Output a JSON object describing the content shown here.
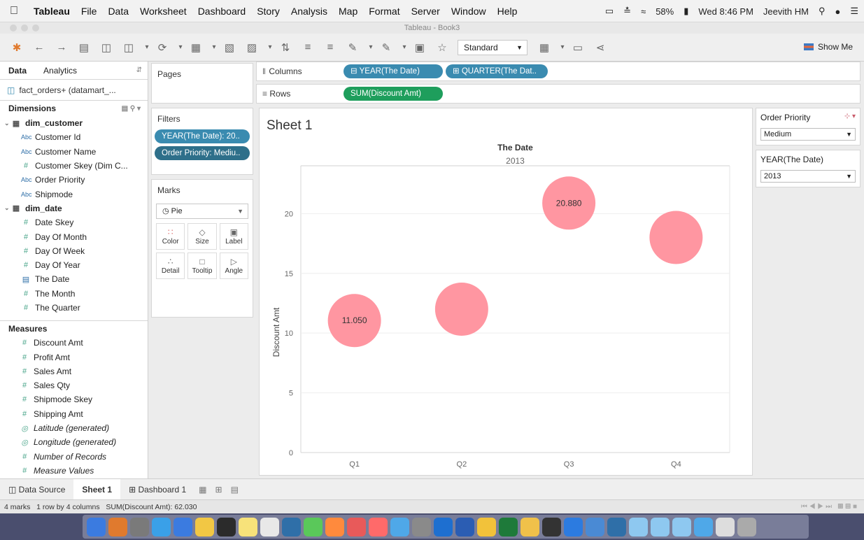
{
  "menubar": {
    "app": "Tableau",
    "items": [
      "File",
      "Data",
      "Worksheet",
      "Dashboard",
      "Story",
      "Analysis",
      "Map",
      "Format",
      "Server",
      "Window",
      "Help"
    ],
    "battery": "58%",
    "clock": "Wed 8:46 PM",
    "user": "Jeevith HM"
  },
  "window": {
    "title": "Tableau - Book3"
  },
  "toolbar": {
    "fit_select": "Standard",
    "show_me": "Show Me"
  },
  "data_pane": {
    "tab_data": "Data",
    "tab_analytics": "Analytics",
    "datasource": "fact_orders+ (datamart_...",
    "dimensions_label": "Dimensions",
    "dim_customer": {
      "name": "dim_customer",
      "fields": [
        {
          "type": "Abc",
          "name": "Customer Id"
        },
        {
          "type": "Abc",
          "name": "Customer Name"
        },
        {
          "type": "#",
          "name": "Customer Skey (Dim C..."
        },
        {
          "type": "Abc",
          "name": "Order Priority"
        },
        {
          "type": "Abc",
          "name": "Shipmode"
        }
      ]
    },
    "dim_date": {
      "name": "dim_date",
      "fields": [
        {
          "type": "#",
          "name": "Date Skey"
        },
        {
          "type": "#",
          "name": "Day Of Month"
        },
        {
          "type": "#",
          "name": "Day Of Week"
        },
        {
          "type": "#",
          "name": "Day Of Year"
        },
        {
          "type": "date",
          "name": "The Date"
        },
        {
          "type": "#",
          "name": "The Month"
        },
        {
          "type": "#",
          "name": "The Quarter"
        }
      ]
    },
    "measures_label": "Measures",
    "measures": [
      {
        "type": "#",
        "name": "Discount Amt",
        "italic": false
      },
      {
        "type": "#",
        "name": "Profit Amt",
        "italic": false
      },
      {
        "type": "#",
        "name": "Sales Amt",
        "italic": false
      },
      {
        "type": "#",
        "name": "Sales Qty",
        "italic": false
      },
      {
        "type": "#",
        "name": "Shipmode Skey",
        "italic": false
      },
      {
        "type": "#",
        "name": "Shipping Amt",
        "italic": false
      },
      {
        "type": "globe",
        "name": "Latitude (generated)",
        "italic": true
      },
      {
        "type": "globe",
        "name": "Longitude (generated)",
        "italic": true
      },
      {
        "type": "#",
        "name": "Number of Records",
        "italic": true
      },
      {
        "type": "#",
        "name": "Measure Values",
        "italic": true
      }
    ]
  },
  "cards": {
    "pages": "Pages",
    "filters": "Filters",
    "filter_pills": [
      "YEAR(The Date): 20..",
      "Order Priority: Mediu.."
    ],
    "marks": "Marks",
    "mark_type": "Pie",
    "mark_buttons": [
      "Color",
      "Size",
      "Label",
      "Detail",
      "Tooltip",
      "Angle"
    ]
  },
  "shelves": {
    "columns_label": "Columns",
    "columns_pills": [
      "YEAR(The Date)",
      "QUARTER(The Dat.."
    ],
    "rows_label": "Rows",
    "rows_pills": [
      "SUM(Discount Amt)"
    ]
  },
  "sheet": {
    "title": "Sheet 1"
  },
  "chart_data": {
    "type": "scatter",
    "header_title": "The Date",
    "header_value": "2013",
    "categories": [
      "Q1",
      "Q2",
      "Q3",
      "Q4"
    ],
    "values": [
      11.05,
      12.0,
      20.88,
      18.0
    ],
    "labels": [
      "11.050",
      "",
      "20.880",
      ""
    ],
    "ylabel": "Discount Amt",
    "yticks": [
      0,
      5,
      10,
      15,
      20
    ],
    "ylim": [
      0,
      24
    ],
    "mark_color": "#ff96a1"
  },
  "quick_filters": [
    {
      "title": "Order Priority",
      "value": "Medium"
    },
    {
      "title": "YEAR(The Date)",
      "value": "2013"
    }
  ],
  "tabs": {
    "data_source": "Data Source",
    "sheet1": "Sheet 1",
    "dashboard1": "Dashboard 1"
  },
  "status": {
    "marks": "4 marks",
    "layout": "1 row by 4 columns",
    "sum": "SUM(Discount Amt): 62.030"
  }
}
